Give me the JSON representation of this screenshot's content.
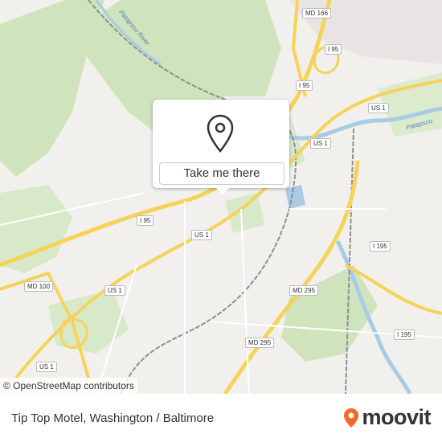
{
  "map": {
    "road_labels": [
      "MD 166",
      "I 95",
      "I 95",
      "US 1",
      "I 95",
      "US 1",
      "US 1",
      "MD 100",
      "US 1",
      "US 1",
      "I 195",
      "MD 295",
      "MD 295",
      "I 195"
    ],
    "river_labels": [
      "Patapsco River",
      "Patapsco"
    ],
    "colors": {
      "land": "#f2f0ec",
      "park": "#cfe3bd",
      "highway": "#f5d35a",
      "water": "#a9cbe6",
      "rail": "#8f8f8f"
    }
  },
  "popup": {
    "pin_icon": "map-pin",
    "button_label": "Take me there"
  },
  "attribution": {
    "text": "© OpenStreetMap contributors"
  },
  "footer": {
    "place_name": "Tip Top Motel, Washington / Baltimore",
    "brand": "moovit",
    "brand_color": "#f46a25"
  }
}
